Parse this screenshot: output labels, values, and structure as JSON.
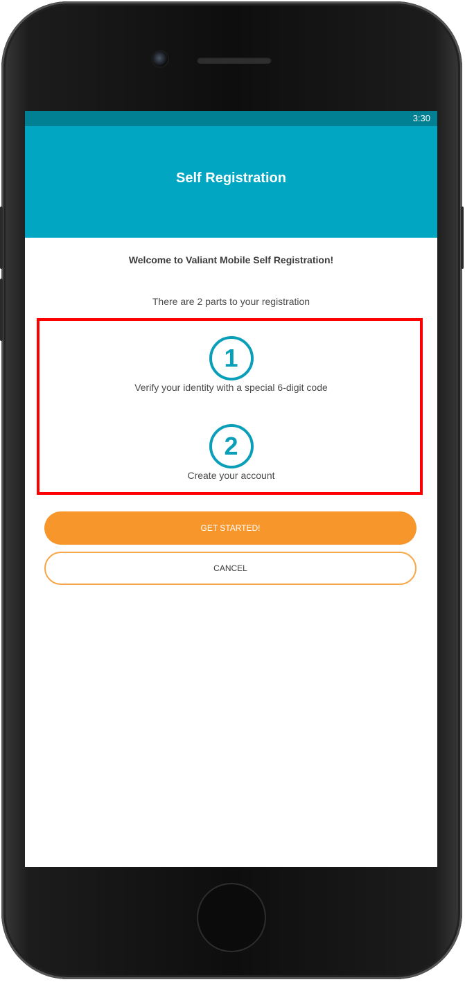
{
  "status_bar": {
    "time": "3:30"
  },
  "app_bar": {
    "title": "Self Registration"
  },
  "content": {
    "welcome": "Welcome to Valiant Mobile Self Registration!",
    "parts_intro": "There are 2 parts to your registration",
    "steps": [
      {
        "number": "1",
        "label": "Verify your identity with a special 6-digit code"
      },
      {
        "number": "2",
        "label": "Create your account"
      }
    ]
  },
  "actions": {
    "get_started": "GET STARTED!",
    "cancel": "CANCEL"
  },
  "colors": {
    "status_bar": "#017f93",
    "app_bar": "#00a6c2",
    "accent_circle": "#0a9fb8",
    "primary_button": "#f7962a",
    "highlight_border": "#ff0000"
  }
}
